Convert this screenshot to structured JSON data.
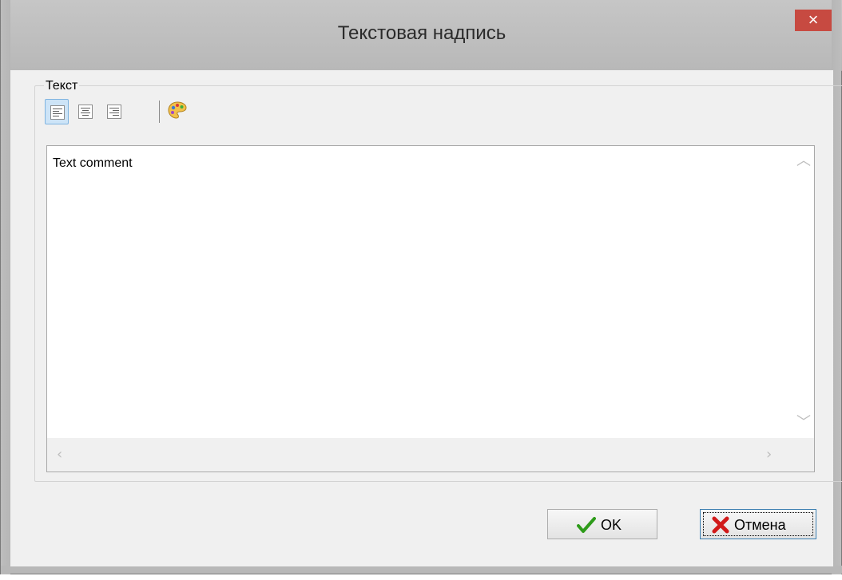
{
  "window": {
    "title": "Текстовая надпись",
    "close_glyph": "×"
  },
  "group": {
    "label": "Текст"
  },
  "toolbar": {
    "buttons": [
      {
        "icon": "align-left-icon",
        "active": true
      },
      {
        "icon": "align-center-icon",
        "active": false
      },
      {
        "icon": "align-right-icon",
        "active": false
      },
      {
        "icon": "palette-icon",
        "active": false
      }
    ]
  },
  "editor": {
    "text": "Text comment"
  },
  "buttons": {
    "ok_label": "OK",
    "cancel_label": "Отмена"
  },
  "colors": {
    "close_button": "#c74a41",
    "ok_check": "#2e9b1a",
    "cancel_x": "#d11a1a",
    "active_tool_bg": "#cde4f7"
  }
}
